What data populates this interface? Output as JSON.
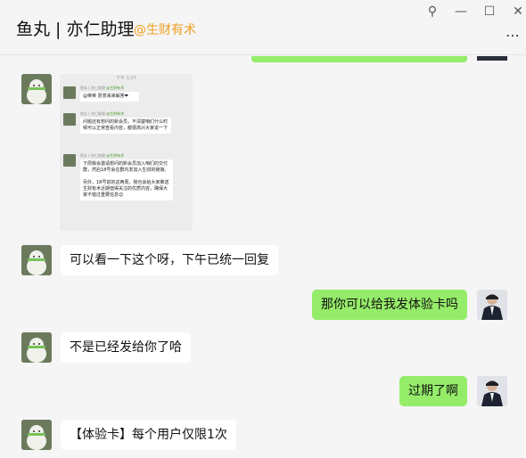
{
  "window": {
    "title": "鱼丸 | 亦仁助理",
    "subtitle": "@生财有术",
    "pin_glyph": "⚲",
    "minimize_glyph": "—",
    "maximize_glyph": "☐",
    "close_glyph": "✕",
    "more_glyph": "⋯"
  },
  "screenshot": {
    "time": "下午 1:37",
    "msg1": {
      "name": "鱼丸 | 亦仁助理",
      "tag": "@生财有术",
      "text": "@荣荣 愿意来来解答❤"
    },
    "msg2": {
      "name": "鱼丸 | 亦仁助理",
      "tag": "@生财有术",
      "text": "问题还有想问的新会员，不清楚咱们什么时候可以正常查看内容，都很高兴大家说一下"
    },
    "msg3": {
      "name": "鱼丸 | 亦仁助理",
      "tag": "@生财有术",
      "text1": "下周我会邀请想问的新会员加入咱们的交付群，然后18号会在群内发加入生财的链接。",
      "text2": "另外，18号前的这两周，我也会给大家推送生财有术近期值得关注的优质内容，确保大家不错过重要信息😊"
    }
  },
  "messages": [
    {
      "side": "left",
      "text": "可以看一下这个呀，下午已统一回复"
    },
    {
      "side": "right",
      "text": "那你可以给我发体验卡吗"
    },
    {
      "side": "left",
      "text": "不是已经发给你了哈"
    },
    {
      "side": "right",
      "text": "过期了啊"
    },
    {
      "side": "left",
      "text": "【体验卡】每个用户仅限1次"
    }
  ]
}
